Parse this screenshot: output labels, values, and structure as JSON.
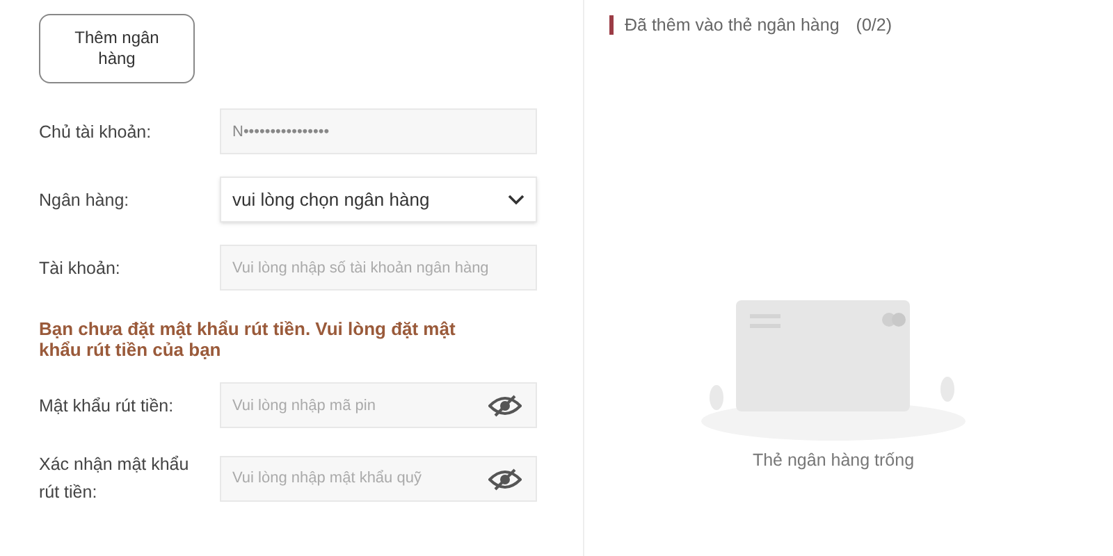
{
  "add_button": "Thêm ngân hàng",
  "form": [
    {
      "kind": "text",
      "label": "Chủ tài khoản:",
      "value": "N••••••••••••••••"
    },
    {
      "kind": "select",
      "label": "Ngân hàng:",
      "value": "vui lòng chọn ngân hàng"
    },
    {
      "kind": "text",
      "label": "Tài khoản:",
      "placeholder": "Vui lòng nhập số tài khoản ngân hàng"
    },
    {
      "kind": "warning",
      "text": "Bạn chưa đặt mật khẩu rút tiền. Vui lòng đặt mật khẩu rút tiền của bạn"
    },
    {
      "kind": "password",
      "label": "Mật khẩu rút tiền:",
      "placeholder": "Vui lòng nhập mã pin"
    },
    {
      "kind": "password",
      "label": "Xác nhận mật khẩu rút tiền:",
      "placeholder": "Vui lòng nhập mật khẩu quỹ"
    }
  ],
  "cards_panel": {
    "title": "Đã thêm vào thẻ ngân hàng",
    "count": "(0/2)",
    "empty_text": "Thẻ ngân hàng trống"
  }
}
